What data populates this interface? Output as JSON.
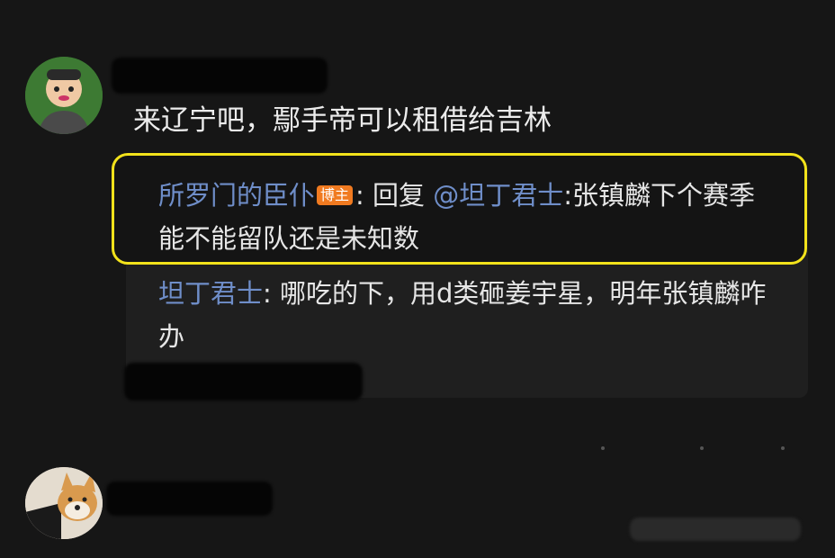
{
  "comment": {
    "text": "来辽宁吧，鄢手帝可以租借给吉林"
  },
  "replies": [
    {
      "user": "所罗门的臣仆",
      "badge": "博主",
      "separator": ": ",
      "action": "回复 ",
      "mention": "@坦丁君士",
      "text": ":张镇麟下个赛季能不能留队还是未知数"
    },
    {
      "user": "坦丁君士",
      "separator": ": ",
      "text": "哪吃的下，用d类砸姜宇星，明年张镇麟咋办"
    }
  ],
  "colors": {
    "background": "#161616",
    "username": "#6f8ec9",
    "badge": "#f07a20",
    "highlight_border": "#f2e21b"
  }
}
